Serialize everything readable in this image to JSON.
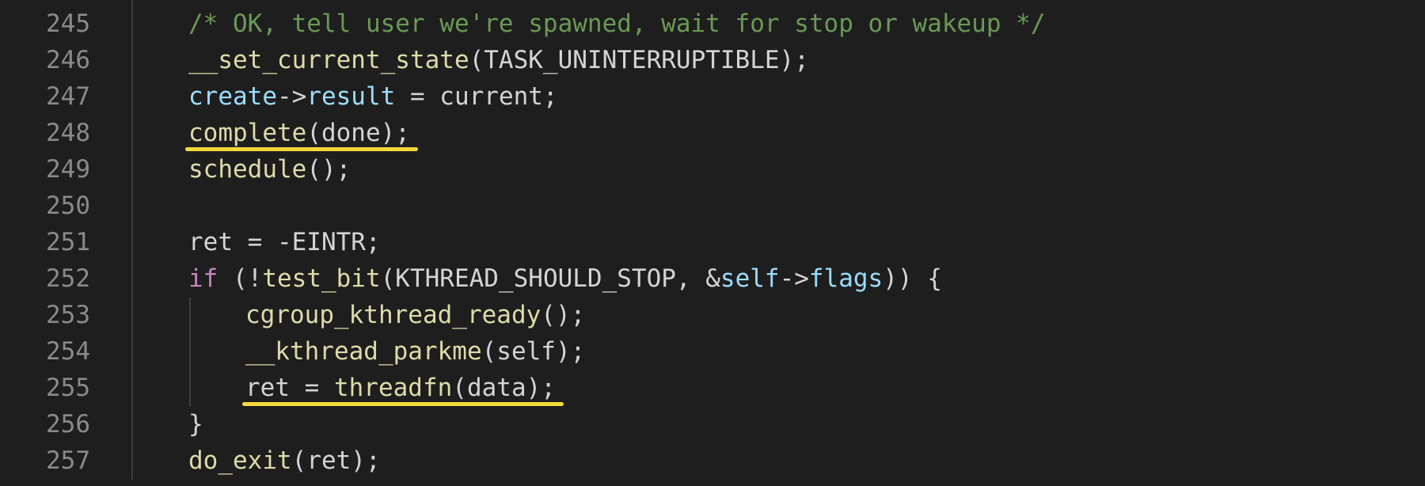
{
  "colors": {
    "background": "#1e1e1e",
    "line_number": "#8a8a8a",
    "comment": "#6a9955",
    "function": "#dcdcaa",
    "variable": "#9cdcfe",
    "keyword": "#c586c0",
    "plain": "#d4d4d4",
    "highlight_underline": "#f4d93b"
  },
  "lines": [
    {
      "number": "245",
      "indent": 0,
      "tokens": [
        {
          "t": "/* OK, tell user we're spawned, wait for stop or wakeup */",
          "c": "comment"
        }
      ]
    },
    {
      "number": "246",
      "indent": 0,
      "tokens": [
        {
          "t": "__set_current_state",
          "c": "func"
        },
        {
          "t": "(TASK_UNINTERRUPTIBLE);",
          "c": "plain"
        }
      ]
    },
    {
      "number": "247",
      "indent": 0,
      "tokens": [
        {
          "t": "create",
          "c": "var"
        },
        {
          "t": "->",
          "c": "plain"
        },
        {
          "t": "result",
          "c": "var"
        },
        {
          "t": " = current;",
          "c": "plain"
        }
      ]
    },
    {
      "number": "248",
      "indent": 0,
      "underline": true,
      "tokens": [
        {
          "t": "complete",
          "c": "func"
        },
        {
          "t": "(done);",
          "c": "plain"
        }
      ]
    },
    {
      "number": "249",
      "indent": 0,
      "tokens": [
        {
          "t": "schedule",
          "c": "func"
        },
        {
          "t": "();",
          "c": "plain"
        }
      ]
    },
    {
      "number": "250",
      "indent": 0,
      "tokens": []
    },
    {
      "number": "251",
      "indent": 0,
      "tokens": [
        {
          "t": "ret = -EINTR;",
          "c": "plain"
        }
      ]
    },
    {
      "number": "252",
      "indent": 0,
      "tokens": [
        {
          "t": "if",
          "c": "kw"
        },
        {
          "t": " (!",
          "c": "plain"
        },
        {
          "t": "test_bit",
          "c": "func"
        },
        {
          "t": "(KTHREAD_SHOULD_STOP, &",
          "c": "plain"
        },
        {
          "t": "self",
          "c": "var"
        },
        {
          "t": "->",
          "c": "plain"
        },
        {
          "t": "flags",
          "c": "var"
        },
        {
          "t": ")) {",
          "c": "plain"
        }
      ]
    },
    {
      "number": "253",
      "indent": 1,
      "tokens": [
        {
          "t": "cgroup_kthread_ready",
          "c": "func"
        },
        {
          "t": "();",
          "c": "plain"
        }
      ]
    },
    {
      "number": "254",
      "indent": 1,
      "tokens": [
        {
          "t": "__kthread_parkme",
          "c": "func"
        },
        {
          "t": "(self);",
          "c": "plain"
        }
      ]
    },
    {
      "number": "255",
      "indent": 1,
      "underline": true,
      "tokens": [
        {
          "t": "ret = ",
          "c": "plain"
        },
        {
          "t": "threadfn",
          "c": "func"
        },
        {
          "t": "(data);",
          "c": "plain"
        }
      ]
    },
    {
      "number": "256",
      "indent": 0,
      "tokens": [
        {
          "t": "}",
          "c": "plain"
        }
      ]
    },
    {
      "number": "257",
      "indent": 0,
      "tokens": [
        {
          "t": "do_exit",
          "c": "func"
        },
        {
          "t": "(ret);",
          "c": "plain"
        }
      ]
    }
  ]
}
